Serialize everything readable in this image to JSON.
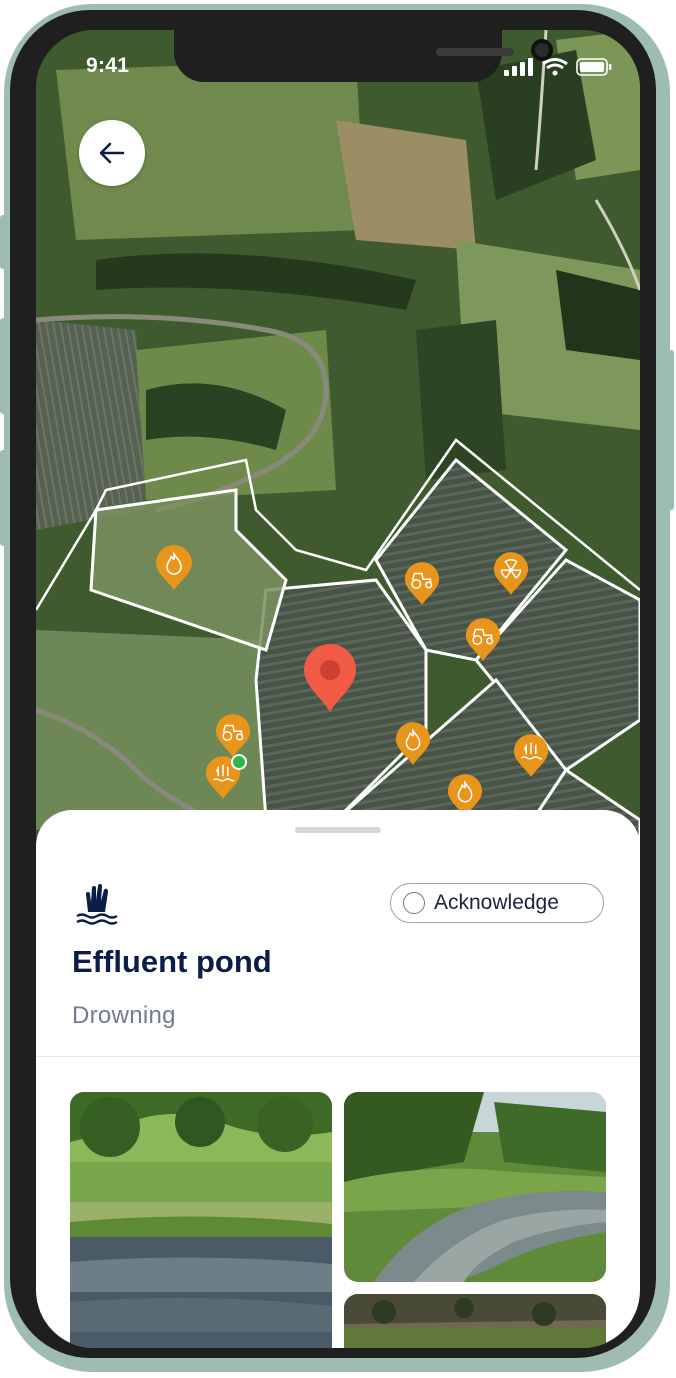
{
  "status_bar": {
    "time": "9:41"
  },
  "map": {
    "title": "hazard-map"
  },
  "hazard": {
    "name": "Effluent pond",
    "type": "Drowning",
    "acknowledge_label": "Acknowledge"
  },
  "colors": {
    "marker_orange": "#e8951b",
    "selected_marker": "#f15b46",
    "title_navy": "#0d1d4a",
    "frame": "#9fbcb4"
  },
  "markers": [
    "fire-icon",
    "tractor-icon",
    "radiation-icon",
    "tractor-icon",
    "fire-icon",
    "drowning-icon",
    "tractor-icon",
    "drowning-icon",
    "fire-icon"
  ]
}
